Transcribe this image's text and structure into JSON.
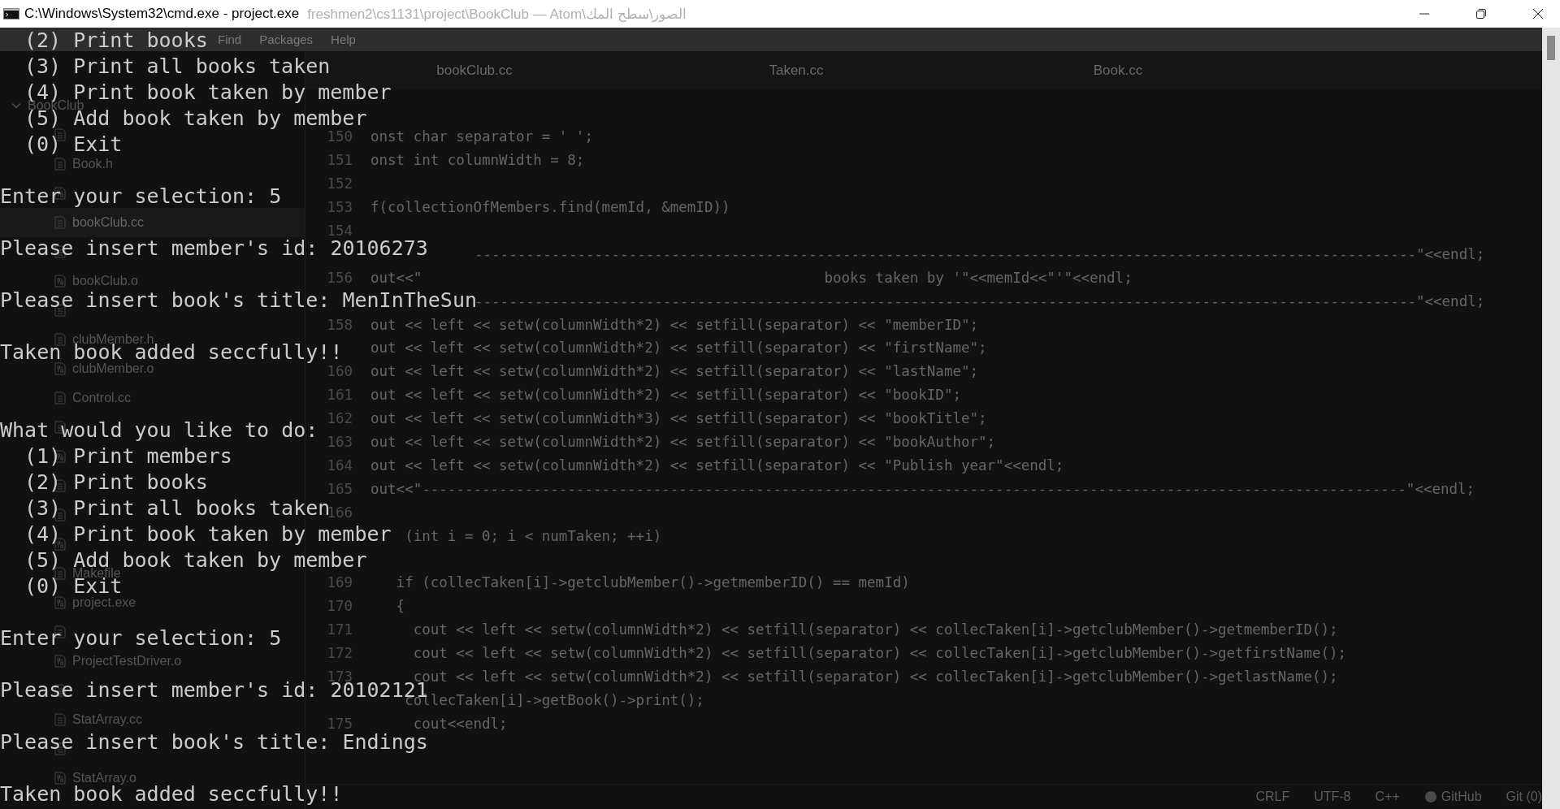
{
  "window": {
    "title": "C:\\Windows\\System32\\cmd.exe - project.exe",
    "background_title": "الصور\\سطح المك\\freshmen2\\cs1131\\project\\BookClub — Atom"
  },
  "editor": {
    "menu": [
      "Find",
      "Packages",
      "Help"
    ],
    "tree": [
      {
        "label": "BookClub",
        "expanded": true,
        "children": [
          {
            "kind": "text",
            "selected": false
          },
          {
            "label": "Book.h",
            "kind": "text",
            "selected": false
          },
          {
            "kind": "binary",
            "selected": false
          },
          {
            "label": "bookClub.cc",
            "kind": "text",
            "selected": true
          },
          {
            "kind": "text",
            "selected": false
          },
          {
            "label": "bookClub.o",
            "kind": "binary",
            "selected": false
          },
          {
            "kind": "text",
            "selected": false
          },
          {
            "label": "clubMember.h",
            "kind": "text",
            "selected": false
          },
          {
            "label": "clubMember.o",
            "kind": "binary",
            "selected": false
          },
          {
            "label": "Control.cc",
            "kind": "text",
            "selected": false
          },
          {
            "kind": "text",
            "selected": false
          },
          {
            "kind": "binary",
            "selected": false
          },
          {
            "kind": "text",
            "selected": false
          },
          {
            "kind": "text",
            "selected": false
          },
          {
            "kind": "binary",
            "selected": false
          },
          {
            "label": "Makefile",
            "kind": "text",
            "selected": false
          },
          {
            "label": "project.exe",
            "kind": "binary",
            "selected": false
          },
          {
            "kind": "text",
            "selected": false
          },
          {
            "label": "ProjectTestDriver.o",
            "kind": "binary",
            "selected": false
          },
          {
            "kind": "text",
            "selected": false
          },
          {
            "label": "StatArray.cc",
            "kind": "text",
            "selected": false
          },
          {
            "kind": "text",
            "selected": false
          },
          {
            "label": "StatArray.o",
            "kind": "binary",
            "selected": false
          }
        ]
      }
    ],
    "tabs": [
      "bookClub.cc",
      "Taken.cc",
      "Book.cc"
    ],
    "code": [
      {
        "number": "150",
        "code": "onst char separator = ' ';"
      },
      {
        "number": "151",
        "code": "onst int columnWidth = 8;"
      },
      {
        "number": "152"
      },
      {
        "number": "153",
        "code": "f(collectionOfMembers.find(memId, &memID))"
      },
      {
        "number": "154"
      },
      {
        "kind": "rule",
        "code": "--------------------------------------------------------------------------------------------------------------\"<<endl;"
      },
      {
        "number": "156",
        "code": "out<<\"                                               books taken by '\"<<memId<<\"'\"<<endl;"
      },
      {
        "kind": "rule",
        "code": "--------------------------------------------------------------------------------------------------------------\"<<endl;"
      },
      {
        "number": "158",
        "code": "out << left << setw(columnWidth*2) << setfill(separator) << \"memberID\";"
      },
      {
        "code": "out << left << setw(columnWidth*2) << setfill(separator) << \"firstName\";"
      },
      {
        "number": "160",
        "code": "out << left << setw(columnWidth*2) << setfill(separator) << \"lastName\";"
      },
      {
        "number": "161",
        "code": "out << left << setw(columnWidth*2) << setfill(separator) << \"bookID\";"
      },
      {
        "number": "162",
        "code": "out << left << setw(columnWidth*3) << setfill(separator) << \"bookTitle\";"
      },
      {
        "number": "163",
        "code": "out << left << setw(columnWidth*2) << setfill(separator) << \"bookAuthor\";"
      },
      {
        "number": "164",
        "code": "out << left << setw(columnWidth*2) << setfill(separator) << \"Publish year\"<<endl;"
      },
      {
        "number": "165",
        "code": "out<<\"-------------------------------------------------------------------------------------------------------------------\"<<endl;"
      },
      {
        "number": "166"
      },
      {
        "code": "    (int i = 0; i < numTaken; ++i)"
      },
      {
        "kind": "blank"
      },
      {
        "number": "169",
        "code": "   if (collecTaken[i]->getclubMember()->getmemberID() == memId)"
      },
      {
        "number": "170",
        "code": "   {"
      },
      {
        "number": "171",
        "code": "     cout << left << setw(columnWidth*2) << setfill(separator) << collecTaken[i]->getclubMember()->getmemberID();"
      },
      {
        "number": "172",
        "code": "     cout << left << setw(columnWidth*2) << setfill(separator) << collecTaken[i]->getclubMember()->getfirstName();"
      },
      {
        "number": "173",
        "code": "     cout << left << setw(columnWidth*2) << setfill(separator) << collecTaken[i]->getclubMember()->getlastName();"
      },
      {
        "code": "    collecTaken[i]->getBook()->print();"
      },
      {
        "number": "175",
        "code": "     cout<<endl;"
      }
    ],
    "status": [
      "CRLF",
      "UTF-8",
      "C++",
      "GitHub",
      "Git (0)"
    ]
  },
  "console": [
    {
      "text": "(2) Print books",
      "kind": "option"
    },
    {
      "text": "(3) Print all books taken",
      "kind": "option"
    },
    {
      "text": "(4) Print book taken by member",
      "kind": "option"
    },
    {
      "text": "(5) Add book taken by member",
      "kind": "option"
    },
    {
      "text": "(0) Exit",
      "kind": "option"
    },
    {
      "text": "Enter your selection: 5",
      "kind": "message"
    },
    {
      "text": "Please insert member's id: 20106273",
      "kind": "message"
    },
    {
      "text": "Please insert book's title: MenInTheSun",
      "kind": "message"
    },
    {
      "text": "Taken book added seccfully!!",
      "kind": "message"
    },
    {
      "text": "What would you like to do:",
      "kind": "menu_title"
    },
    {
      "text": "(1) Print members",
      "kind": "option"
    },
    {
      "text": "(2) Print books",
      "kind": "option"
    },
    {
      "text": "(3) Print all books taken",
      "kind": "option"
    },
    {
      "text": "(4) Print book taken by member",
      "kind": "option"
    },
    {
      "text": "(5) Add book taken by member",
      "kind": "option"
    },
    {
      "text": "(0) Exit",
      "kind": "option"
    },
    {
      "text": "Enter your selection: 5",
      "kind": "message"
    },
    {
      "text": "Please insert member's id: 20102121",
      "kind": "message"
    },
    {
      "text": "Please insert book's title: Endings",
      "kind": "message"
    },
    {
      "text": "Taken book added seccfully!!",
      "kind": "message"
    }
  ]
}
